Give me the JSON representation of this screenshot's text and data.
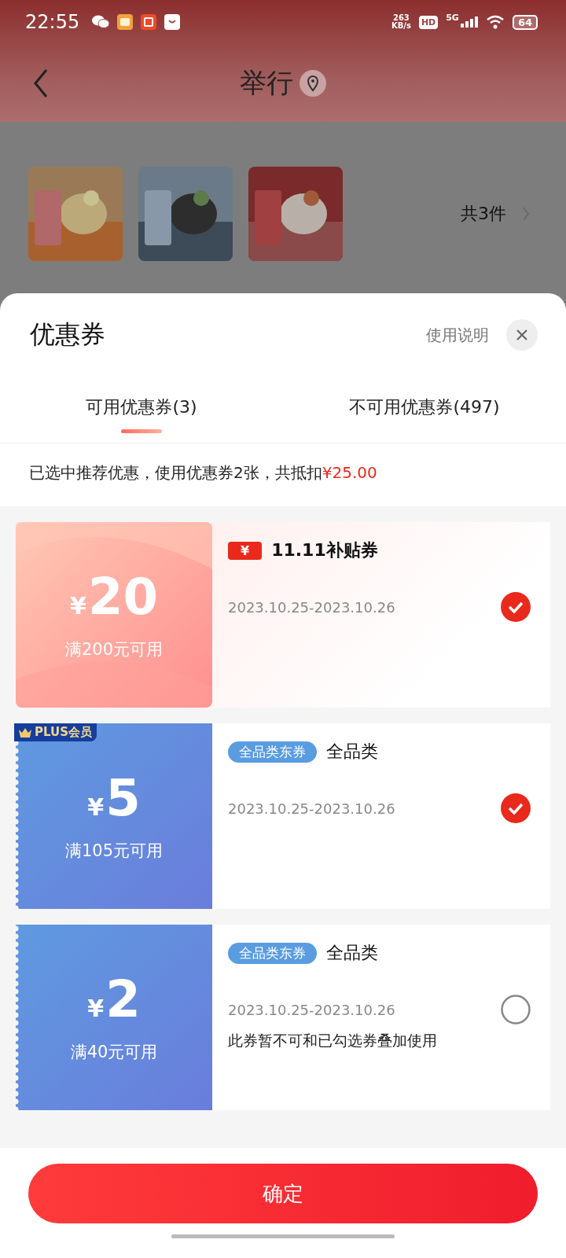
{
  "status_bar": {
    "time": "22:55",
    "speed_value": "263",
    "speed_unit": "KB/s",
    "hd": "HD",
    "network": "5G",
    "battery": "64"
  },
  "header": {
    "title": "举行"
  },
  "products": {
    "count": "共3件"
  },
  "sheet": {
    "title": "优惠券",
    "help": "使用说明",
    "tabs": [
      {
        "label": "可用优惠券(3)",
        "selected": true
      },
      {
        "label": "不可用优惠券(497)",
        "selected": false
      }
    ],
    "summary": {
      "text": "已选中推荐优惠，使用优惠券2张，共抵扣",
      "amount": "¥25.00"
    },
    "coupons": [
      {
        "kind": "festival",
        "currency": "¥",
        "amount": "20",
        "condition": "满200元可用",
        "badge": "¥",
        "title": "11.11补贴券",
        "validity": "2023.10.25-2023.10.26",
        "checked": true
      },
      {
        "kind": "standard",
        "plus": "PLUS会员",
        "currency": "¥",
        "amount": "5",
        "condition": "满105元可用",
        "tag": "全品类东券",
        "title": "全品类",
        "validity": "2023.10.25-2023.10.26",
        "checked": true
      },
      {
        "kind": "standard",
        "currency": "¥",
        "amount": "2",
        "condition": "满40元可用",
        "tag": "全品类东券",
        "title": "全品类",
        "validity": "2023.10.25-2023.10.26",
        "note": "此券暂不可和已勾选券叠加使用",
        "checked": false
      }
    ],
    "confirm": "确定"
  }
}
